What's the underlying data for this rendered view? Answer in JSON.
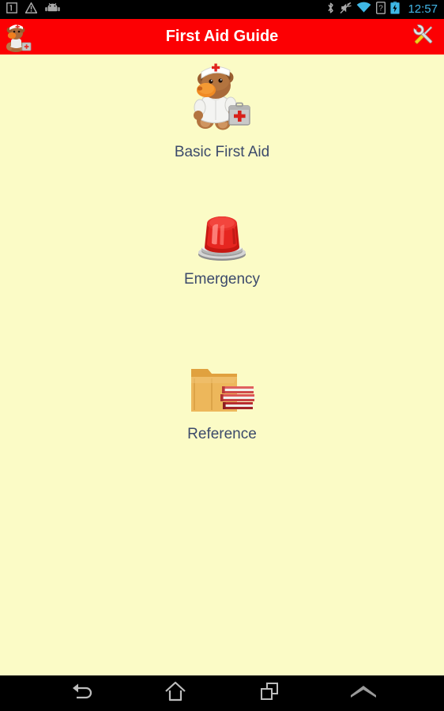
{
  "status_bar": {
    "left_icons": [
      {
        "name": "sim-notification-icon",
        "label": "1"
      },
      {
        "name": "warning-triangle-icon",
        "label": "!"
      },
      {
        "name": "android-head-icon",
        "label": "android"
      }
    ],
    "right_icons": [
      {
        "name": "bluetooth-icon",
        "label": "bluetooth"
      },
      {
        "name": "mute-icon",
        "label": "muted"
      },
      {
        "name": "wifi-icon",
        "label": "wifi"
      },
      {
        "name": "unknown-sim-icon",
        "label": "?"
      },
      {
        "name": "battery-charging-icon",
        "label": "charging"
      }
    ],
    "time": "12:57",
    "time_color": "#42b7e8",
    "background_color": "#000000"
  },
  "action_bar": {
    "title": "First Aid Guide",
    "background_color": "#fc0003",
    "title_color": "#ffffff",
    "logo_icon": "first-aid-bear-logo",
    "settings_icon": "tools-wrench-screwdriver-icon"
  },
  "content": {
    "background_color": "#fbfbc6",
    "label_color": "#3c4a6b",
    "menu_items": [
      {
        "label": "Basic First Aid",
        "icon": "nurse-bear-icon"
      },
      {
        "label": "Emergency",
        "icon": "emergency-siren-icon"
      },
      {
        "label": "Reference",
        "icon": "folder-books-icon"
      }
    ]
  },
  "nav_bar": {
    "background_color": "#000000",
    "buttons": [
      {
        "name": "back",
        "icon": "back-arrow-icon",
        "label": "Back"
      },
      {
        "name": "home",
        "icon": "home-icon",
        "label": "Home"
      },
      {
        "name": "recent",
        "icon": "recent-apps-icon",
        "label": "Recent apps"
      },
      {
        "name": "menu",
        "icon": "chevron-up-icon",
        "label": "Menu"
      }
    ]
  }
}
